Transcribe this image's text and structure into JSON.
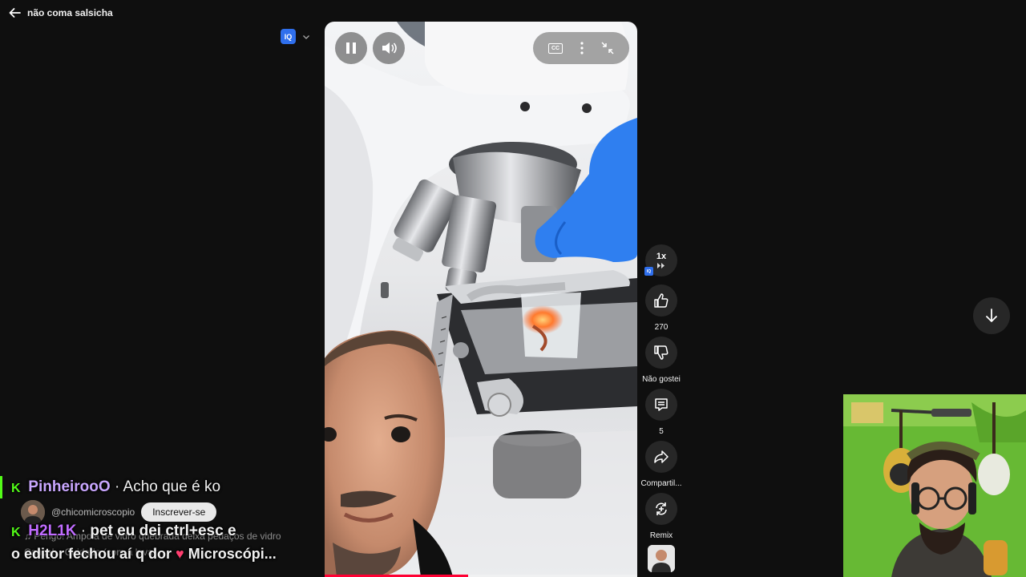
{
  "header": {
    "title": "não coma salsicha"
  },
  "extension": {
    "badge_label": "IQ"
  },
  "player": {
    "cc_label": "CC",
    "progress_fraction": 0.46
  },
  "actions": {
    "speed": {
      "label": "1x",
      "iq": "IQ"
    },
    "like": {
      "count": "270"
    },
    "dislike": {
      "label": "Não gostei"
    },
    "comments": {
      "count": "5"
    },
    "share": {
      "label": "Compartil..."
    },
    "remix": {
      "label": "Remix"
    }
  },
  "channel": {
    "handle": "@chicomicroscopio",
    "subscribe_label": "Inscrever-se",
    "music_text": "♫ Perigo! Ampola de vidro quebrada deixa pedaços de vidro",
    "music_text_2": "Cancel... Cuidado (com a lava)"
  },
  "chat": {
    "messages": [
      {
        "user": "PinheirooO",
        "separator": " · ",
        "text": "Acho que é ko"
      },
      {
        "user": "H2L1K",
        "separator": " · ",
        "text_1": "pet eu dei ctrl+esc e",
        "text_2": "o editor fechou aí q dor ",
        "emote_tail": " Microscópi..."
      }
    ],
    "badge_glyph": "K"
  },
  "colors": {
    "accent_red": "#ff0033",
    "kick_green": "#53fc18",
    "iq_blue": "#2f6fed",
    "background": "#0f0f0f"
  }
}
